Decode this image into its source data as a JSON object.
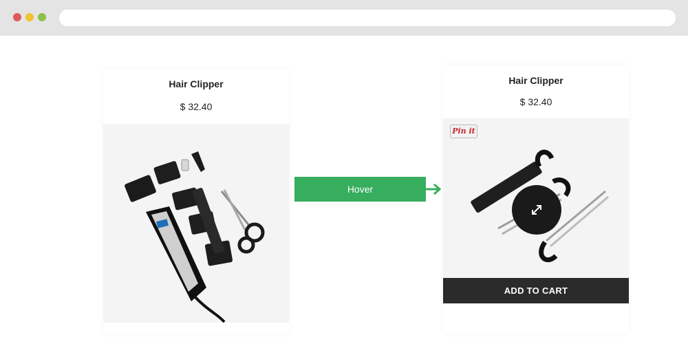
{
  "left_card": {
    "title": "Hair Clipper",
    "price": "$ 32.40",
    "image": "hair-clipper-kit-image"
  },
  "right_card": {
    "title": "Hair Clipper",
    "price": "$ 32.40",
    "image": "scissors-comb-set-image",
    "pin_label": "Pin it",
    "zoom_icon": "expand-arrows-icon",
    "add_to_cart_label": "ADD TO CART"
  },
  "hover_label": "Hover",
  "arrow_icon": "arrow-right-icon",
  "colors": {
    "accent_green": "#37ad5e",
    "cart_bar": "#2b2b2b",
    "pinterest_red": "#c8232c",
    "browser_chrome": "#e4e4e4"
  }
}
